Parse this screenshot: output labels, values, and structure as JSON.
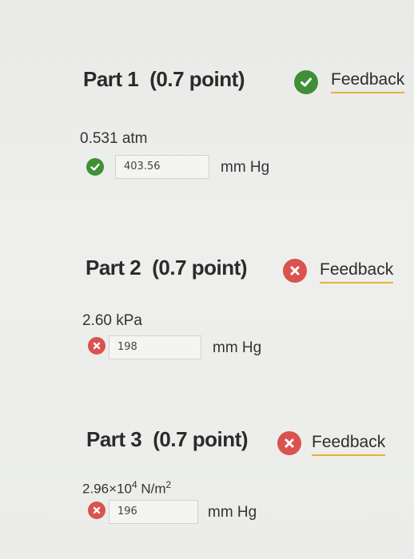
{
  "parts": [
    {
      "label": "Part 1",
      "points": "(0.7 point)",
      "status": "correct",
      "feedback": "Feedback",
      "given": "0.531 atm",
      "answer": "403.56",
      "unit": "mm Hg"
    },
    {
      "label": "Part 2",
      "points": "(0.7 point)",
      "status": "incorrect",
      "feedback": "Feedback",
      "given": "2.60 kPa",
      "answer": "198",
      "unit": "mm Hg"
    },
    {
      "label": "Part 3",
      "points": "(0.7 point)",
      "status": "incorrect",
      "feedback": "Feedback",
      "given_mantissa": "2.96×10",
      "given_exp": "4",
      "given_unit": " N/m",
      "given_unit_exp": "2",
      "answer": "196",
      "unit": "mm Hg"
    }
  ],
  "colors": {
    "correct": "#3f8f37",
    "incorrect": "#d9534f",
    "feedback_underline": "#e0b33a"
  },
  "icons": {
    "correct": "check-circle-icon",
    "incorrect": "x-circle-icon"
  }
}
